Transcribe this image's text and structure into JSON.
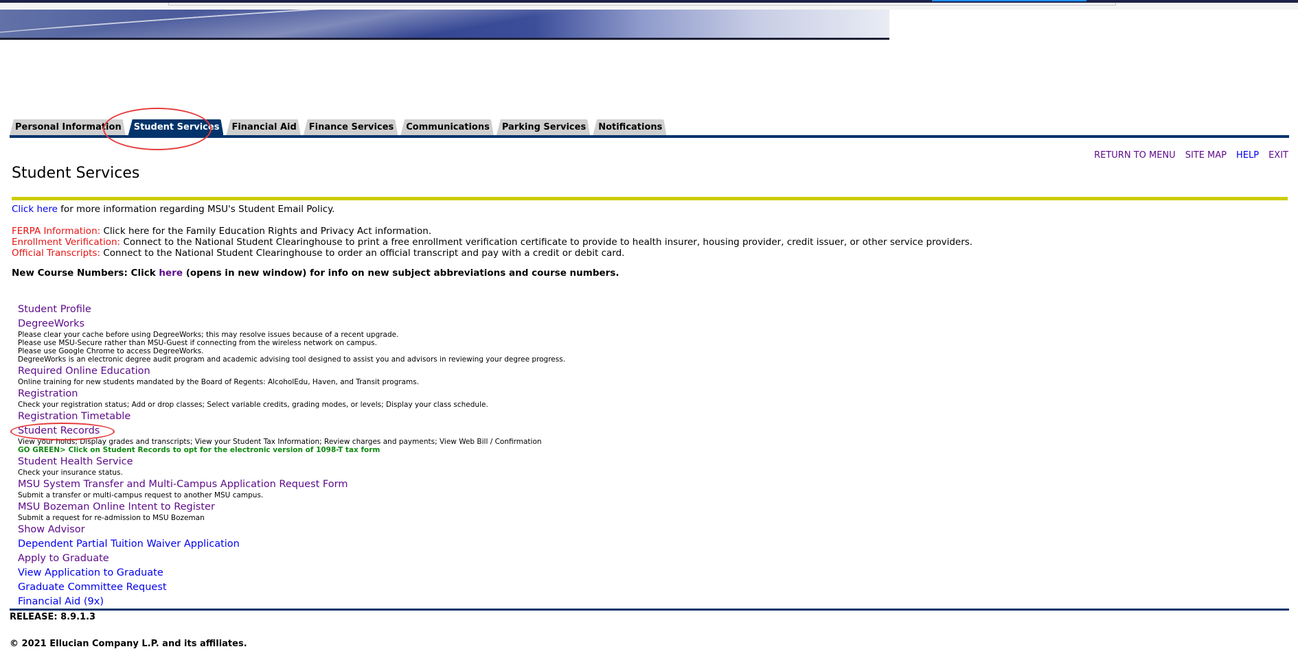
{
  "tabs": [
    {
      "label": "Personal Information",
      "active": false
    },
    {
      "label": "Student Services",
      "active": true
    },
    {
      "label": "Financial Aid",
      "active": false
    },
    {
      "label": "Finance Services",
      "active": false
    },
    {
      "label": "Communications",
      "active": false
    },
    {
      "label": "Parking Services",
      "active": false
    },
    {
      "label": "Notifications",
      "active": false
    }
  ],
  "util_links": {
    "return_to_menu": "RETURN TO MENU",
    "site_map": "SITE MAP",
    "help": "HELP",
    "exit": "EXIT"
  },
  "page_title": "Student Services",
  "email_policy": {
    "link": "Click here",
    "text": " for more information regarding MSU's Student Email Policy."
  },
  "notices": [
    {
      "label": "FERPA Information:",
      "text": " Click here for the Family Education Rights and Privacy Act information."
    },
    {
      "label": "Enrollment Verification:",
      "text": " Connect to the National Student Clearinghouse to print a free enrollment verification certificate to provide to health insurer, housing provider, credit issuer, or other service providers."
    },
    {
      "label": "Official Transcripts:",
      "text": " Connect to the National Student Clearinghouse to order an official transcript and pay with a credit or debit card."
    }
  ],
  "course_numbers": {
    "prefix": "New Course Numbers: Click ",
    "link": "here",
    "suffix": " (opens in new window) for info on new subject abbreviations and course numbers."
  },
  "menu": [
    {
      "label": "Student Profile",
      "visited": true,
      "desc": []
    },
    {
      "label": "DegreeWorks",
      "visited": true,
      "desc": [
        "Please clear your cache before using DegreeWorks; this may resolve issues because of a recent upgrade.",
        "Please use MSU-Secure rather than MSU-Guest if connecting from the wireless network on campus.",
        "Please use Google Chrome to access DegreeWorks.",
        "DegreeWorks is an electronic degree audit program and academic advising tool designed to assist you and advisors in reviewing your degree progress."
      ]
    },
    {
      "label": "Required Online Education",
      "visited": true,
      "desc": [
        "Online training for new students mandated by the Board of Regents: AlcoholEdu, Haven, and Transit programs."
      ]
    },
    {
      "label": "Registration",
      "visited": true,
      "desc": [
        "Check your registration status; Add or drop classes; Select variable credits, grading modes, or levels; Display your class schedule."
      ]
    },
    {
      "label": "Registration Timetable",
      "visited": true,
      "desc": []
    },
    {
      "label": "Student Records",
      "visited": true,
      "desc": [
        "View your holds; Display grades and transcripts; View your Student Tax Information; Review charges and payments; View Web Bill / Confirmation"
      ],
      "green": "GO GREEN> Click on Student Records to opt for the electronic version of 1098-T tax form"
    },
    {
      "label": "Student Health Service",
      "visited": true,
      "desc": [
        "Check your insurance status."
      ]
    },
    {
      "label": "MSU System Transfer and Multi-Campus Application Request Form",
      "visited": true,
      "desc": [
        "Submit a transfer or multi-campus request to another MSU campus."
      ]
    },
    {
      "label": "MSU Bozeman Online Intent to Register",
      "visited": true,
      "desc": [
        "Submit a request for re-admission to MSU Bozeman"
      ]
    },
    {
      "label": "Show Advisor",
      "visited": true,
      "desc": []
    },
    {
      "label": "Dependent Partial Tuition Waiver Application",
      "visited": false,
      "desc": []
    },
    {
      "label": "Apply to Graduate",
      "visited": true,
      "desc": []
    },
    {
      "label": "View Application to Graduate",
      "visited": false,
      "desc": []
    },
    {
      "label": "Graduate Committee Request",
      "visited": false,
      "desc": []
    },
    {
      "label": "Financial Aid (9x)",
      "visited": false,
      "desc": []
    }
  ],
  "release": "RELEASE: 8.9.1.3",
  "copyright": "© 2021 Ellucian Company L.P. and its affiliates.",
  "colors": {
    "tab_active": "#02346b",
    "visited_link": "#5d0a8a",
    "unvisited_link": "#0000ee",
    "notice_label": "#e81313",
    "go_green": "#118a11",
    "rule": "#cccc00",
    "annotation": "#e53c3c"
  }
}
